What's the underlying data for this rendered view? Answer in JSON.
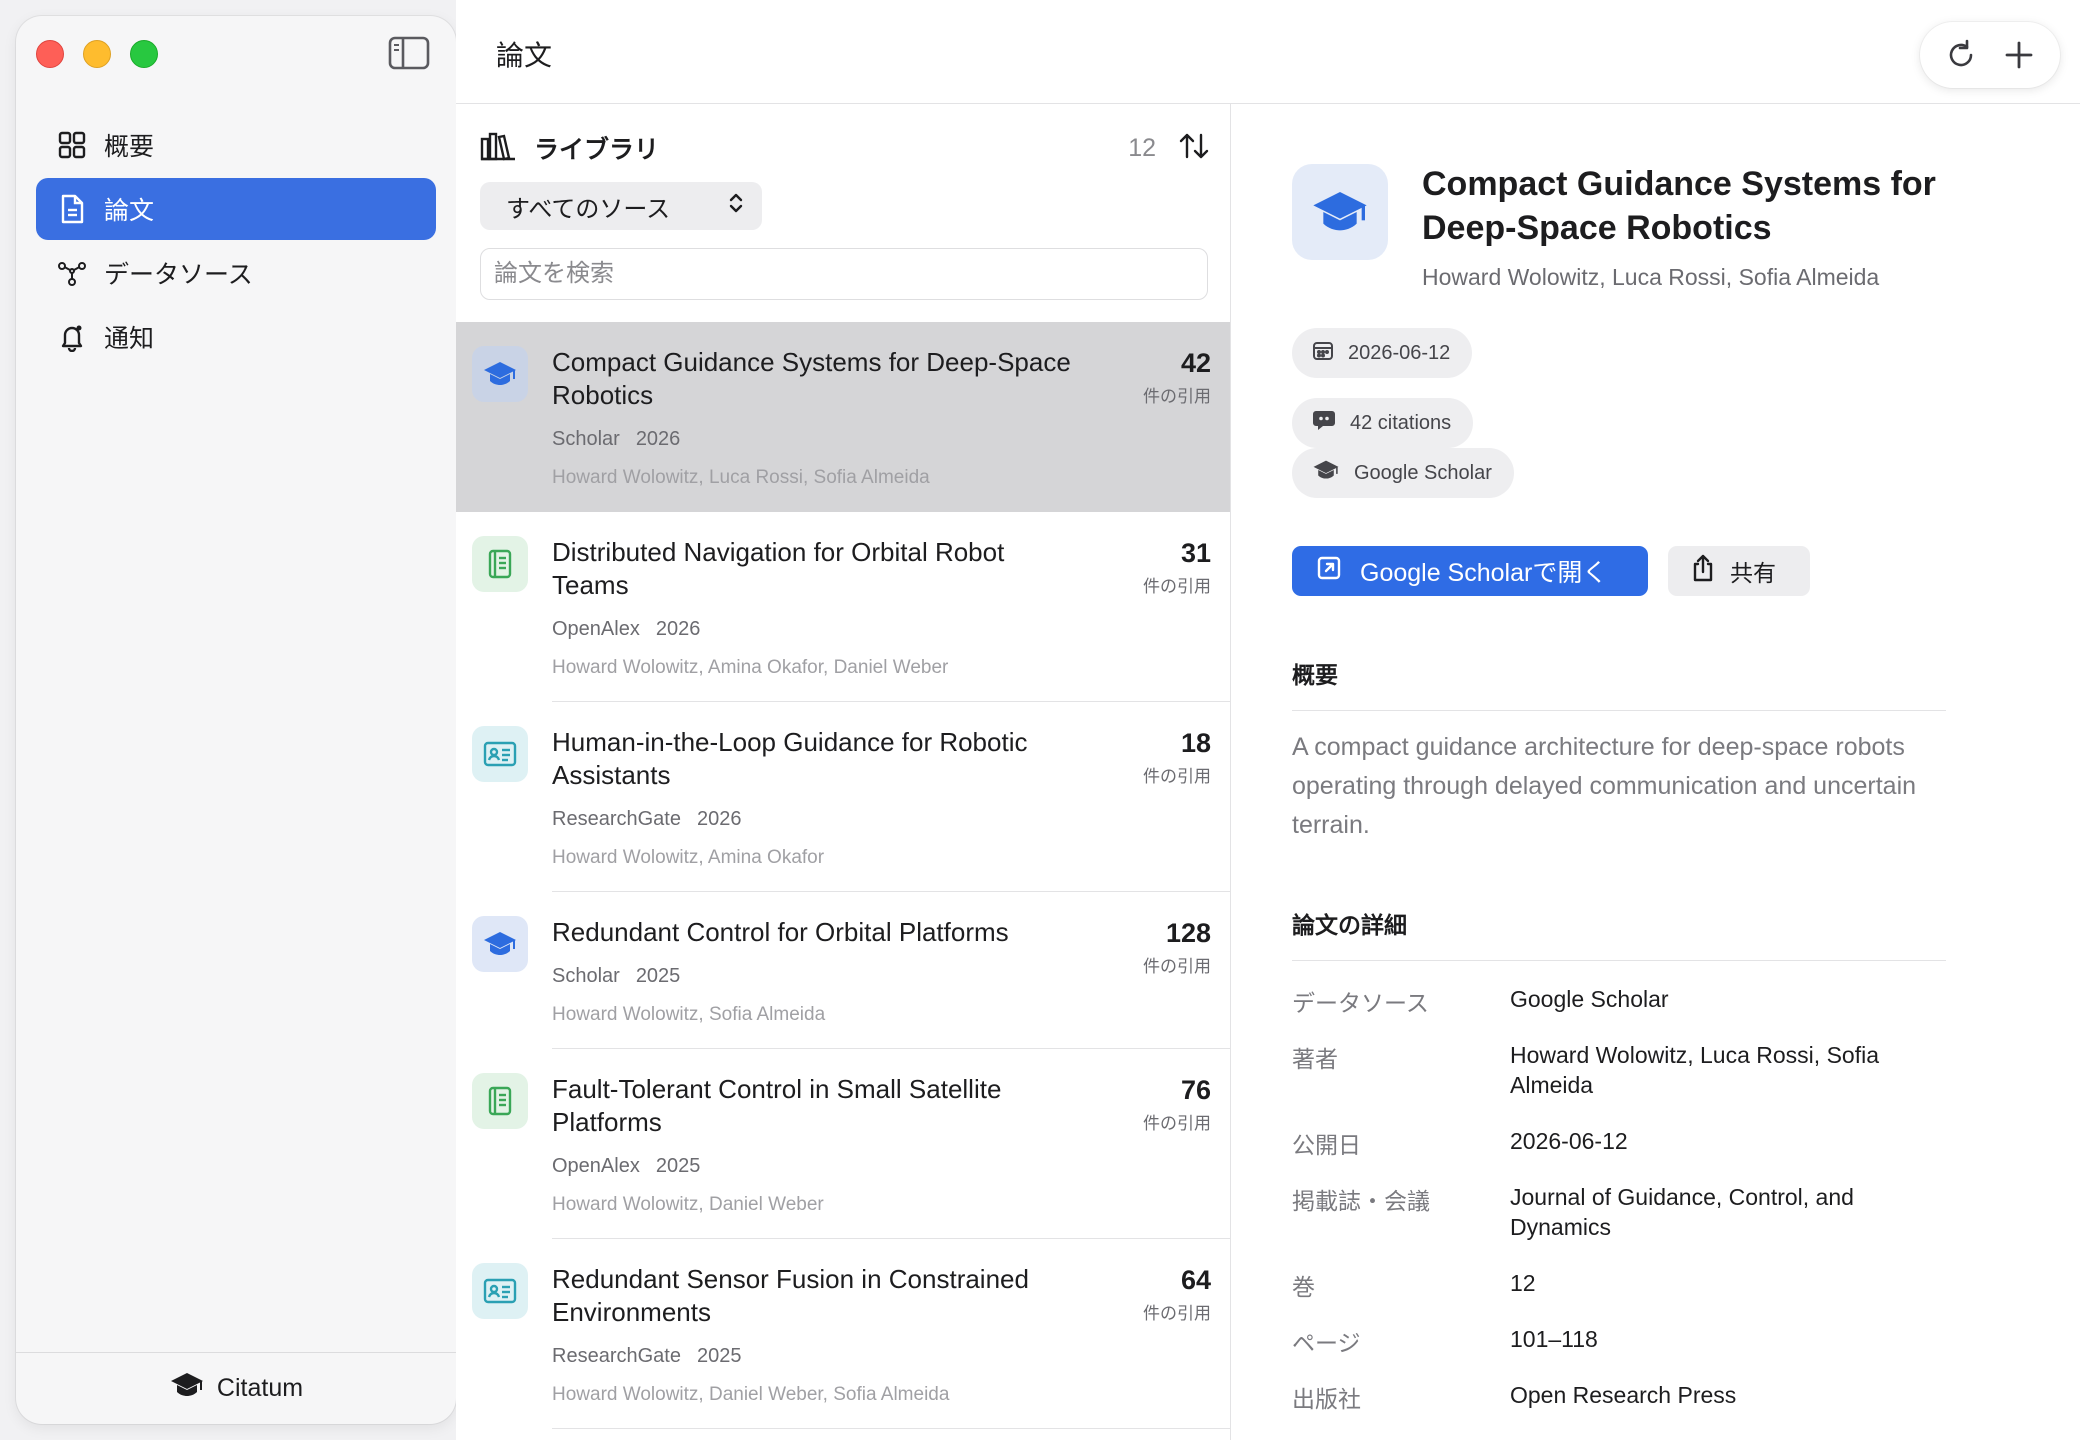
{
  "header": {
    "title": "論文"
  },
  "sidebar": {
    "items": [
      {
        "label": "概要",
        "icon": "grid-icon"
      },
      {
        "label": "論文",
        "icon": "document-icon",
        "active": true
      },
      {
        "label": "データソース",
        "icon": "network-icon"
      },
      {
        "label": "通知",
        "icon": "bell-icon"
      }
    ],
    "footer": {
      "label": "Citatum",
      "icon": "graduation-cap-icon"
    }
  },
  "library": {
    "title": "ライブラリ",
    "count": "12",
    "source_filter": "すべてのソース",
    "search_placeholder": "論文を検索",
    "citation_label": "件の引用"
  },
  "papers": [
    {
      "title": "Compact Guidance Systems for Deep-Space Robotics",
      "source": "Scholar",
      "year": "2026",
      "authors": "Howard Wolowitz, Luca Rossi, Sofia Almeida",
      "citations": "42",
      "icon": "graduation-cap-icon",
      "selected": true
    },
    {
      "title": "Distributed Navigation for Orbital Robot Teams",
      "source": "OpenAlex",
      "year": "2026",
      "authors": "Howard Wolowitz, Amina Okafor, Daniel Weber",
      "citations": "31",
      "icon": "journal-icon"
    },
    {
      "title": "Human-in-the-Loop Guidance for Robotic Assistants",
      "source": "ResearchGate",
      "year": "2026",
      "authors": "Howard Wolowitz, Amina Okafor",
      "citations": "18",
      "icon": "id-card-icon"
    },
    {
      "title": "Redundant Control for Orbital Platforms",
      "source": "Scholar",
      "year": "2025",
      "authors": "Howard Wolowitz, Sofia Almeida",
      "citations": "128",
      "icon": "graduation-cap-icon"
    },
    {
      "title": "Fault-Tolerant Control in Small Satellite Platforms",
      "source": "OpenAlex",
      "year": "2025",
      "authors": "Howard Wolowitz, Daniel Weber",
      "citations": "76",
      "icon": "journal-icon"
    },
    {
      "title": "Redundant Sensor Fusion in Constrained Environments",
      "source": "ResearchGate",
      "year": "2025",
      "authors": "Howard Wolowitz, Daniel Weber, Sofia Almeida",
      "citations": "64",
      "icon": "id-card-icon"
    }
  ],
  "detail": {
    "title": "Compact Guidance Systems for Deep-Space Robotics",
    "authors": "Howard Wolowitz, Luca Rossi, Sofia Almeida",
    "date_chip": "2026-06-12",
    "citations_chip": "42 citations",
    "source_chip": "Google Scholar",
    "open_button": "Google Scholarで開く",
    "share_button": "共有",
    "abstract_heading": "概要",
    "abstract": "A compact guidance architecture for deep-space robots operating through delayed communication and uncertain terrain.",
    "details_heading": "論文の詳細",
    "fields": [
      {
        "key": "データソース",
        "value": "Google Scholar"
      },
      {
        "key": "著者",
        "value": "Howard Wolowitz, Luca Rossi, Sofia Almeida"
      },
      {
        "key": "公開日",
        "value": "2026-06-12"
      },
      {
        "key": "掲載誌・会議",
        "value": "Journal of Guidance, Control, and Dynamics"
      },
      {
        "key": "巻",
        "value": "12"
      },
      {
        "key": "ページ",
        "value": "101–118"
      },
      {
        "key": "出版社",
        "value": "Open Research Press"
      }
    ]
  },
  "colors": {
    "accent": "#3a6fe1",
    "primary_button": "#2f6ce5",
    "scholar_icon": "#2d6cdf",
    "openalex_icon": "#3aa757",
    "researchgate_icon": "#2aa0b3"
  }
}
